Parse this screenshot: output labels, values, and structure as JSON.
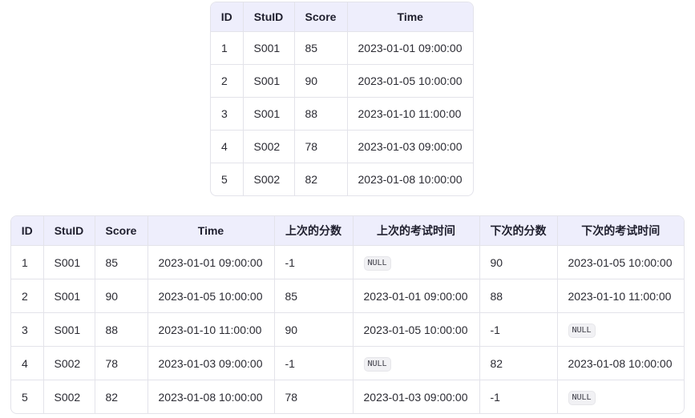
{
  "top_table": {
    "headers": [
      "ID",
      "StuID",
      "Score",
      "Time"
    ],
    "rows": [
      [
        "1",
        "S001",
        "85",
        "2023-01-01 09:00:00"
      ],
      [
        "2",
        "S001",
        "90",
        "2023-01-05 10:00:00"
      ],
      [
        "3",
        "S001",
        "88",
        "2023-01-10 11:00:00"
      ],
      [
        "4",
        "S002",
        "78",
        "2023-01-03 09:00:00"
      ],
      [
        "5",
        "S002",
        "82",
        "2023-01-08 10:00:00"
      ]
    ]
  },
  "bottom_table": {
    "headers": [
      "ID",
      "StuID",
      "Score",
      "Time",
      "上次的分数",
      "上次的考试时间",
      "下次的分数",
      "下次的考试时间"
    ],
    "rows": [
      [
        "1",
        "S001",
        "85",
        "2023-01-01 09:00:00",
        "-1",
        "NULL",
        "90",
        "2023-01-05 10:00:00"
      ],
      [
        "2",
        "S001",
        "90",
        "2023-01-05 10:00:00",
        "85",
        "2023-01-01 09:00:00",
        "88",
        "2023-01-10 11:00:00"
      ],
      [
        "3",
        "S001",
        "88",
        "2023-01-10 11:00:00",
        "90",
        "2023-01-05 10:00:00",
        "-1",
        "NULL"
      ],
      [
        "4",
        "S002",
        "78",
        "2023-01-03 09:00:00",
        "-1",
        "NULL",
        "82",
        "2023-01-08 10:00:00"
      ],
      [
        "5",
        "S002",
        "82",
        "2023-01-08 10:00:00",
        "78",
        "2023-01-03 09:00:00",
        "-1",
        "NULL"
      ]
    ]
  },
  "null_token": "NULL",
  "colors": {
    "header_bg": "#eeeefc",
    "border": "#e3e3ea",
    "null_badge_bg": "#f1f1f4"
  }
}
